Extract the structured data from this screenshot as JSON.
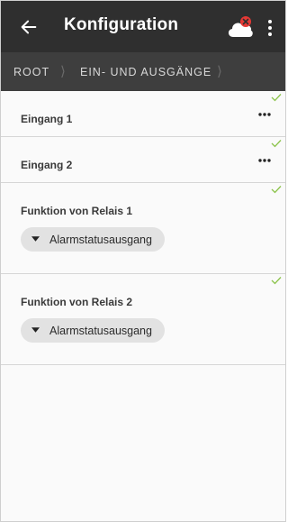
{
  "appbar": {
    "title": "Konfiguration",
    "back_icon": "arrow-left-icon",
    "cloud_icon": "cloud-error-icon",
    "menu_icon": "more-vertical-icon"
  },
  "breadcrumb": {
    "items": [
      "ROOT",
      "EIN- UND AUSGÄNGE"
    ]
  },
  "rows": [
    {
      "label": "Eingang 1"
    },
    {
      "label": "Eingang 2"
    }
  ],
  "relays": [
    {
      "label": "Funktion von Relais 1",
      "value": "Alarmstatusausgang"
    },
    {
      "label": "Funktion von Relais 2",
      "value": "Alarmstatusausgang"
    }
  ],
  "colors": {
    "appbar": "#2f2f2f",
    "breadcrumb": "#3e3e3e",
    "check": "#8bc34a",
    "error": "#e53935"
  }
}
